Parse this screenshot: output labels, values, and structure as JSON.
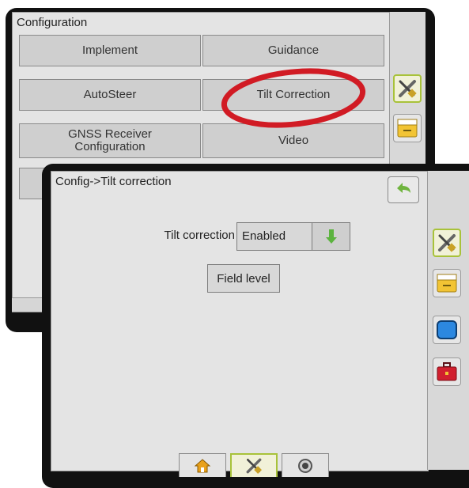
{
  "back_screen": {
    "title": "Configuration",
    "buttons": {
      "implement": "Implement",
      "guidance": "Guidance",
      "autosteer": "AutoSteer",
      "tilt_correction": "Tilt Correction",
      "gnss_line1": "GNSS Receiver",
      "gnss_line2": "Configuration",
      "video": "Video"
    },
    "rail_icons": [
      "tools-icon",
      "console-icon"
    ]
  },
  "front_screen": {
    "title": "Config->Tilt correction",
    "tilt_label": "Tilt correction",
    "tilt_value": "Enabled",
    "field_level_label": "Field level",
    "rail_icons": [
      "tools-icon",
      "console-icon",
      "monitor-icon",
      "toolbox-icon"
    ],
    "bottom_tabs": [
      "home-icon",
      "tools-icon",
      "gnss-icon"
    ]
  },
  "colors": {
    "annotation_ellipse": "#d11b24",
    "active_outline": "#a8c23a",
    "back_arrow": "#6fb43e",
    "dropdown_arrow": "#5cb33f"
  }
}
